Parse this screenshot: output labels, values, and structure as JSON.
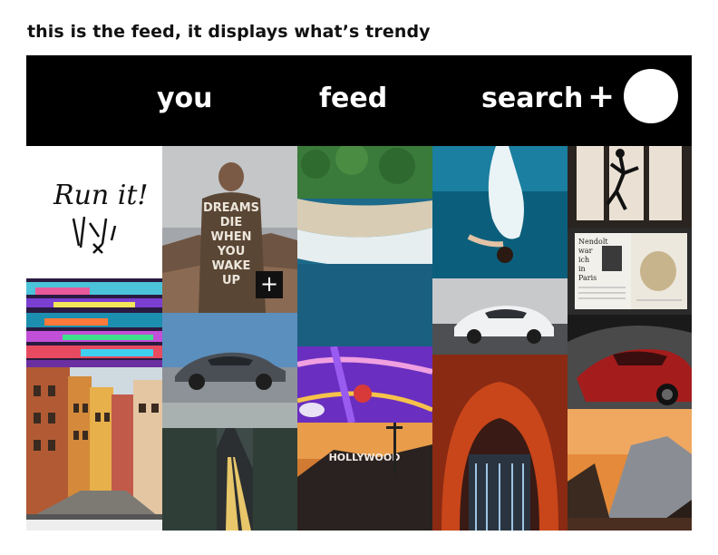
{
  "caption": "this is the feed, it displays what’s trendy",
  "nav": {
    "you": "you",
    "feed": "feed",
    "search": "search",
    "plus": "+"
  },
  "tiles": {
    "run_it": "Run it!",
    "jacket_line1": "DREAMS",
    "jacket_line2": "DIE",
    "jacket_line3": "WHEN",
    "jacket_line4": "YOU",
    "jacket_line5": "WAKE",
    "jacket_line6": "UP",
    "add_symbol": "+",
    "hollywood": "HOLLYWOOD",
    "magazine_line1": "Nendolt",
    "magazine_line2": "war",
    "magazine_line3": "ich",
    "magazine_line4": "in",
    "magazine_line5": "Paris"
  },
  "colors": {
    "frame": "#000000",
    "nav_text": "#ffffff",
    "avatar": "#ffffff"
  }
}
